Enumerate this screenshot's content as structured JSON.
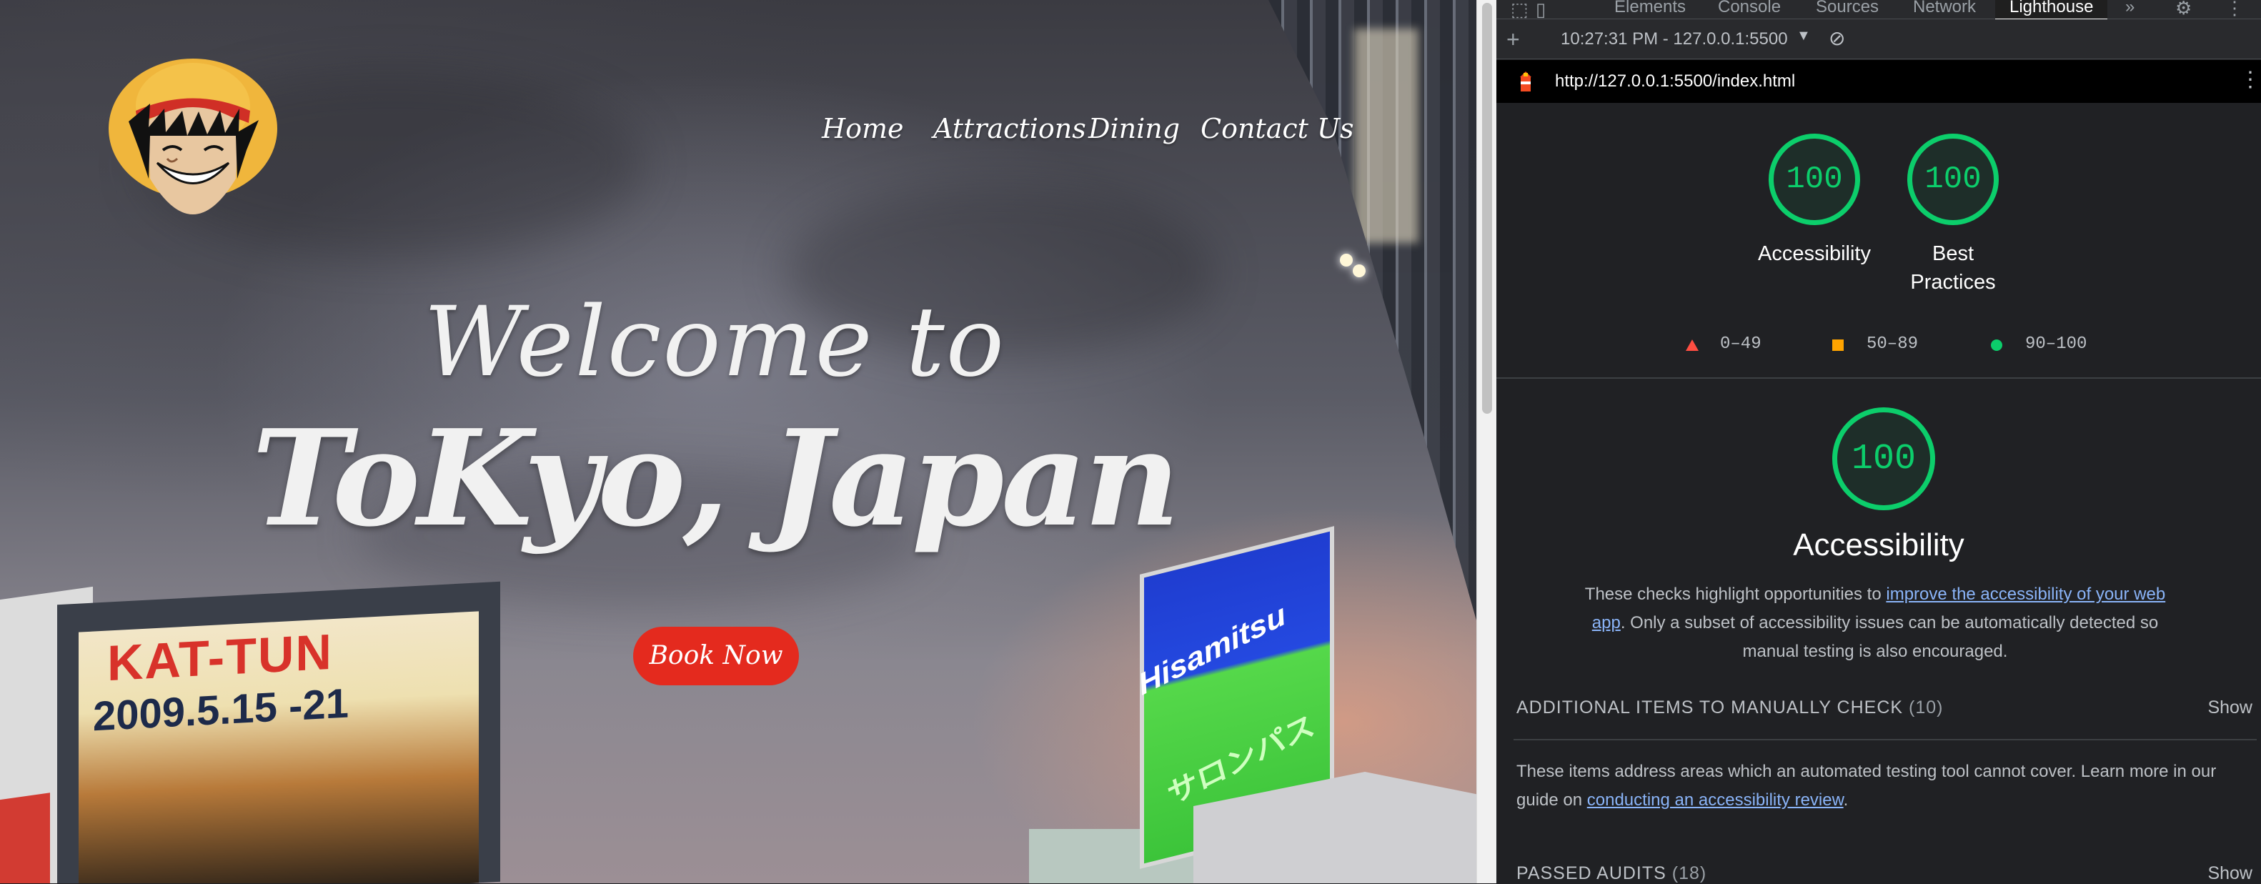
{
  "site": {
    "nav": [
      "Home",
      "Attractions",
      "Dining",
      "Contact Us"
    ],
    "hero_line1": "Welcome to",
    "hero_line2": "ToKyo, Japan",
    "book_button": "Book Now",
    "billboard_title": "KAT-TUN",
    "billboard_date": "2009.5.15 -21",
    "billboard_brand": "Hisamitsu",
    "billboard_jp": "サロンパス"
  },
  "devtools": {
    "tabs": [
      "Elements",
      "Console",
      "Sources",
      "Network",
      "Lighthouse"
    ],
    "active_tab": "Lighthouse",
    "more_tabs": "»",
    "report_select": "10:27:31 PM - 127.0.0.1:5500",
    "url": "http://127.0.0.1:5500/index.html",
    "scores": [
      {
        "label": "Accessibility",
        "value": "100"
      },
      {
        "label_line1": "Best",
        "label_line2": "Practices",
        "value": "100"
      }
    ],
    "legend": [
      {
        "range": "0–49",
        "shape": "triangle",
        "color": "#ff4e42"
      },
      {
        "range": "50–89",
        "shape": "square",
        "color": "#ffa400"
      },
      {
        "range": "90–100",
        "shape": "circle",
        "color": "#0cce6b"
      }
    ],
    "category": {
      "score": "100",
      "title": "Accessibility",
      "desc_before": "These checks highlight opportunities to ",
      "desc_link": "improve the accessibility of your web app",
      "desc_after": ". Only a subset of accessibility issues can be automatically detected so manual testing is also encouraged."
    },
    "manual_group": {
      "title": "ADDITIONAL ITEMS TO MANUALLY CHECK",
      "count": "(10)",
      "show": "Show",
      "desc_before": "These items address areas which an automated testing tool cannot cover. Learn more in our guide on ",
      "desc_link": "conducting an accessibility review",
      "desc_after": "."
    },
    "passed_group": {
      "title": "PASSED AUDITS",
      "count": "(18)",
      "show": "Show"
    },
    "colors": {
      "pass": "#0cce6b",
      "link": "#8ab4f8",
      "panel_bg": "#202124"
    }
  }
}
